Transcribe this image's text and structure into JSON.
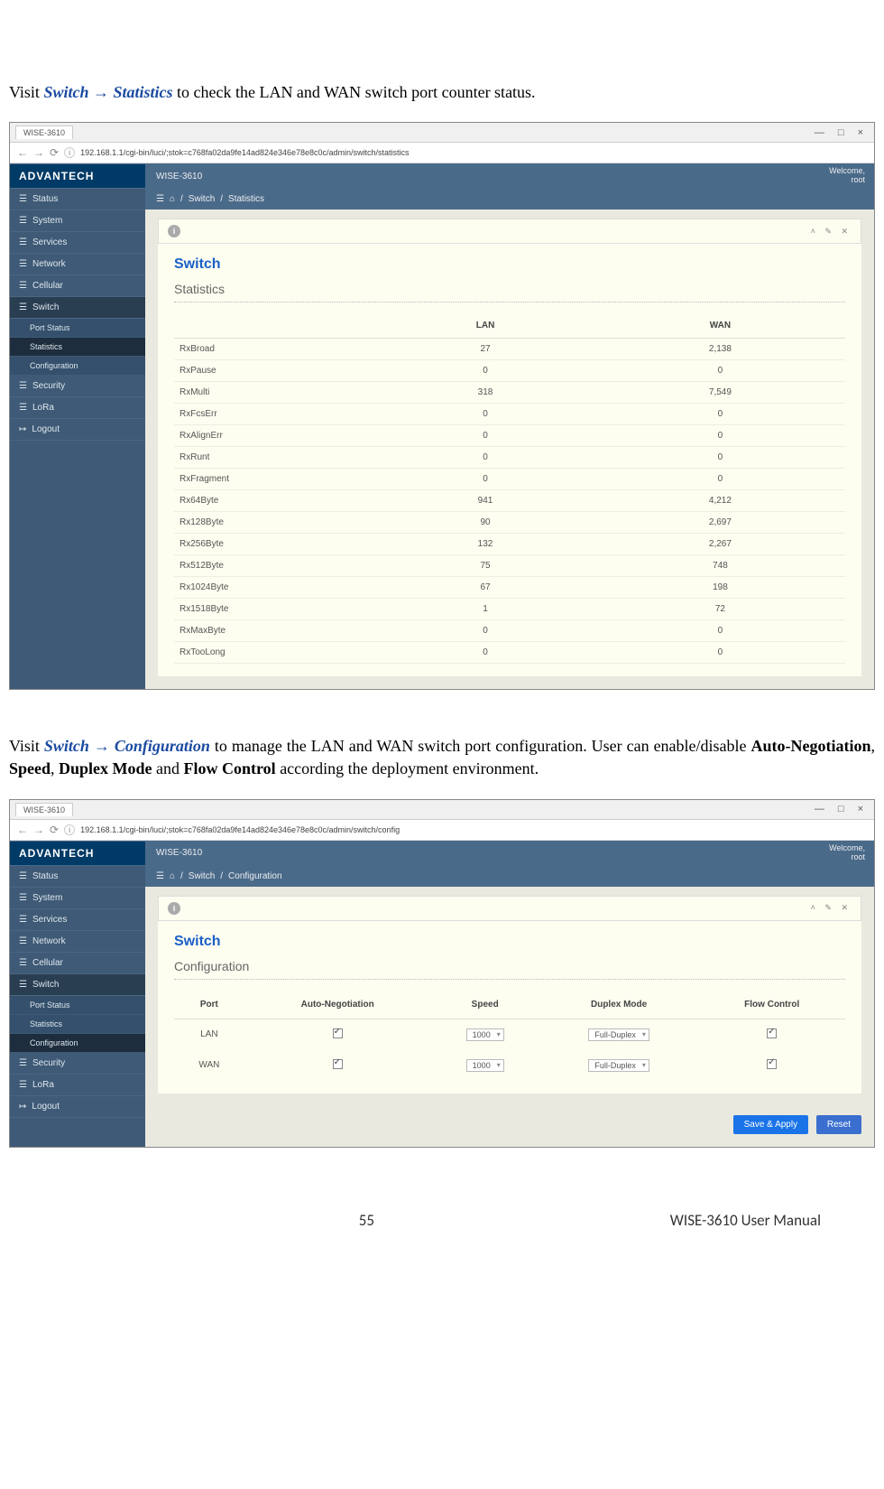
{
  "intro1": {
    "prefix": "Visit ",
    "nav1": "Switch",
    "arrow": " → ",
    "nav2": "Statistics",
    "suffix": " to check the LAN and WAN switch port counter status."
  },
  "intro2": {
    "prefix": "Visit ",
    "nav1": "Switch",
    "arrow": " → ",
    "nav2": "Configuration",
    "mid": " to manage the LAN and WAN switch port configuration. User can enable/disable ",
    "b1": "Auto-Negotiation",
    "s1": ", ",
    "b2": "Speed",
    "s2": ", ",
    "b3": "Duplex Mode",
    "s3": " and ",
    "b4": "Flow Control",
    "suffix": " according the deployment environment."
  },
  "browser": {
    "tab": "WISE-3610",
    "url": "192.168.1.1/cgi-bin/luci/;stok=c768fa02da9fe14ad824e346e78e8c0c/admin/switch/statistics",
    "url2": "192.168.1.1/cgi-bin/luci/;stok=c768fa02da9fe14ad824e346e78e8c0c/admin/switch/config"
  },
  "header": {
    "logo": "ADVANTECH",
    "device": "WISE-3610",
    "welcome": "Welcome,",
    "user": "root"
  },
  "sidebar": [
    "Status",
    "System",
    "Services",
    "Network",
    "Cellular",
    "Switch",
    "Security",
    "LoRa",
    "Logout"
  ],
  "switch_sub": [
    "Port Status",
    "Statistics",
    "Configuration"
  ],
  "crumb": {
    "sep": "/",
    "p1": "Switch",
    "p2a": "Statistics",
    "p2b": "Configuration"
  },
  "panel1": {
    "title": "Switch",
    "subtitle": "Statistics",
    "headers": [
      "",
      "LAN",
      "WAN"
    ],
    "rows": [
      [
        "RxBroad",
        "27",
        "2,138"
      ],
      [
        "RxPause",
        "0",
        "0"
      ],
      [
        "RxMulti",
        "318",
        "7,549"
      ],
      [
        "RxFcsErr",
        "0",
        "0"
      ],
      [
        "RxAlignErr",
        "0",
        "0"
      ],
      [
        "RxRunt",
        "0",
        "0"
      ],
      [
        "RxFragment",
        "0",
        "0"
      ],
      [
        "Rx64Byte",
        "941",
        "4,212"
      ],
      [
        "Rx128Byte",
        "90",
        "2,697"
      ],
      [
        "Rx256Byte",
        "132",
        "2,267"
      ],
      [
        "Rx512Byte",
        "75",
        "748"
      ],
      [
        "Rx1024Byte",
        "67",
        "198"
      ],
      [
        "Rx1518Byte",
        "1",
        "72"
      ],
      [
        "RxMaxByte",
        "0",
        "0"
      ],
      [
        "RxTooLong",
        "0",
        "0"
      ]
    ]
  },
  "panel2": {
    "title": "Switch",
    "subtitle": "Configuration",
    "headers": [
      "Port",
      "Auto-Negotiation",
      "Speed",
      "Duplex Mode",
      "Flow Control"
    ],
    "rows": [
      {
        "port": "LAN",
        "auto": true,
        "speed": "1000",
        "duplex": "Full-Duplex",
        "flow": true
      },
      {
        "port": "WAN",
        "auto": true,
        "speed": "1000",
        "duplex": "Full-Duplex",
        "flow": true
      }
    ],
    "save": "Save & Apply",
    "reset": "Reset"
  },
  "footer": {
    "page": "55",
    "title": "WISE-3610  User  Manual"
  }
}
